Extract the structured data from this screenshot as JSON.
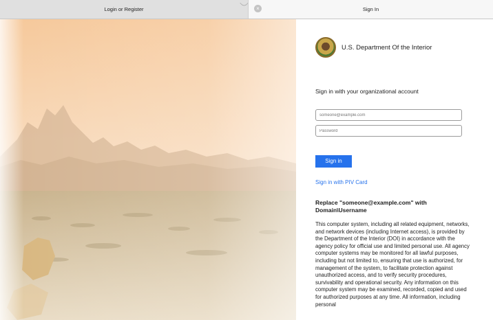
{
  "browser": {
    "tabs": [
      {
        "title": "Login or Register",
        "active": false
      },
      {
        "title": "Sign In",
        "active": true
      }
    ],
    "close_glyph": "×"
  },
  "signin": {
    "org_name": "U.S. Department Of the Interior",
    "heading": "Sign in with your organizational account",
    "email_placeholder": "someone@example.com",
    "password_placeholder": "Password",
    "submit_label": "Sign in",
    "piv_link": "Sign in with PIV Card",
    "replace_heading": "Replace \"someone@example.com\" with Domain\\Username",
    "notice": "This computer system, including all related equipment, networks, and network devices (including Internet access), is provided by the Department of the Interior (DOI) in accordance with the agency policy for official use and limited personal use. All agency computer systems may be monitored for all lawful purposes, including but not limited to, ensuring that use is authorized, for management of the system, to facilitate protection against unauthorized access, and to verify security procedures, survivability and operational security. Any information on this computer system may be examined, recorded, copied and used for authorized purposes at any time. All information, including personal"
  },
  "colors": {
    "accent": "#2672ec",
    "tab_bar": "#e3e3e3"
  }
}
